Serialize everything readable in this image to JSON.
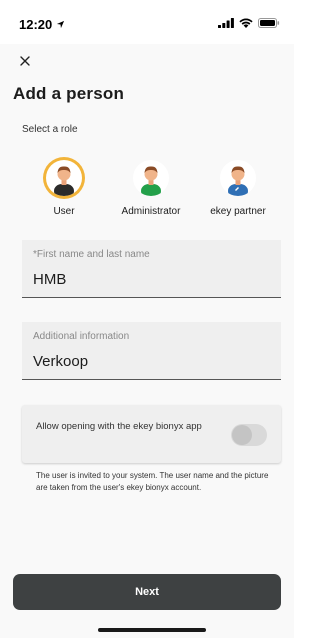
{
  "status_bar": {
    "time": "12:20",
    "icons": [
      "location-arrow-icon",
      "signal-icon",
      "wifi-icon",
      "battery-icon"
    ]
  },
  "header": {
    "close_icon": "close-icon",
    "title": "Add a person"
  },
  "roles": {
    "section_label": "Select a role",
    "items": [
      {
        "label": "User",
        "selected": true,
        "shirt_color": "#2b2b2b"
      },
      {
        "label": "Administrator",
        "selected": false,
        "shirt_color": "#23a04a"
      },
      {
        "label": "ekey partner",
        "selected": false,
        "shirt_color": "#2f6fb5"
      }
    ],
    "selected_ring_color": "#f2b43a"
  },
  "form": {
    "name_field": {
      "label": "*First name and last name",
      "value": "HMB"
    },
    "info_field": {
      "label": "Additional information",
      "value": "Verkoop"
    },
    "toggle": {
      "label": "Allow opening with the ekey bionyx app",
      "enabled": false
    },
    "help_text": "The user is invited to your system. The user name and the picture are taken from the user's ekey bionyx account."
  },
  "footer": {
    "next_label": "Next",
    "button_color": "#3e4142"
  }
}
